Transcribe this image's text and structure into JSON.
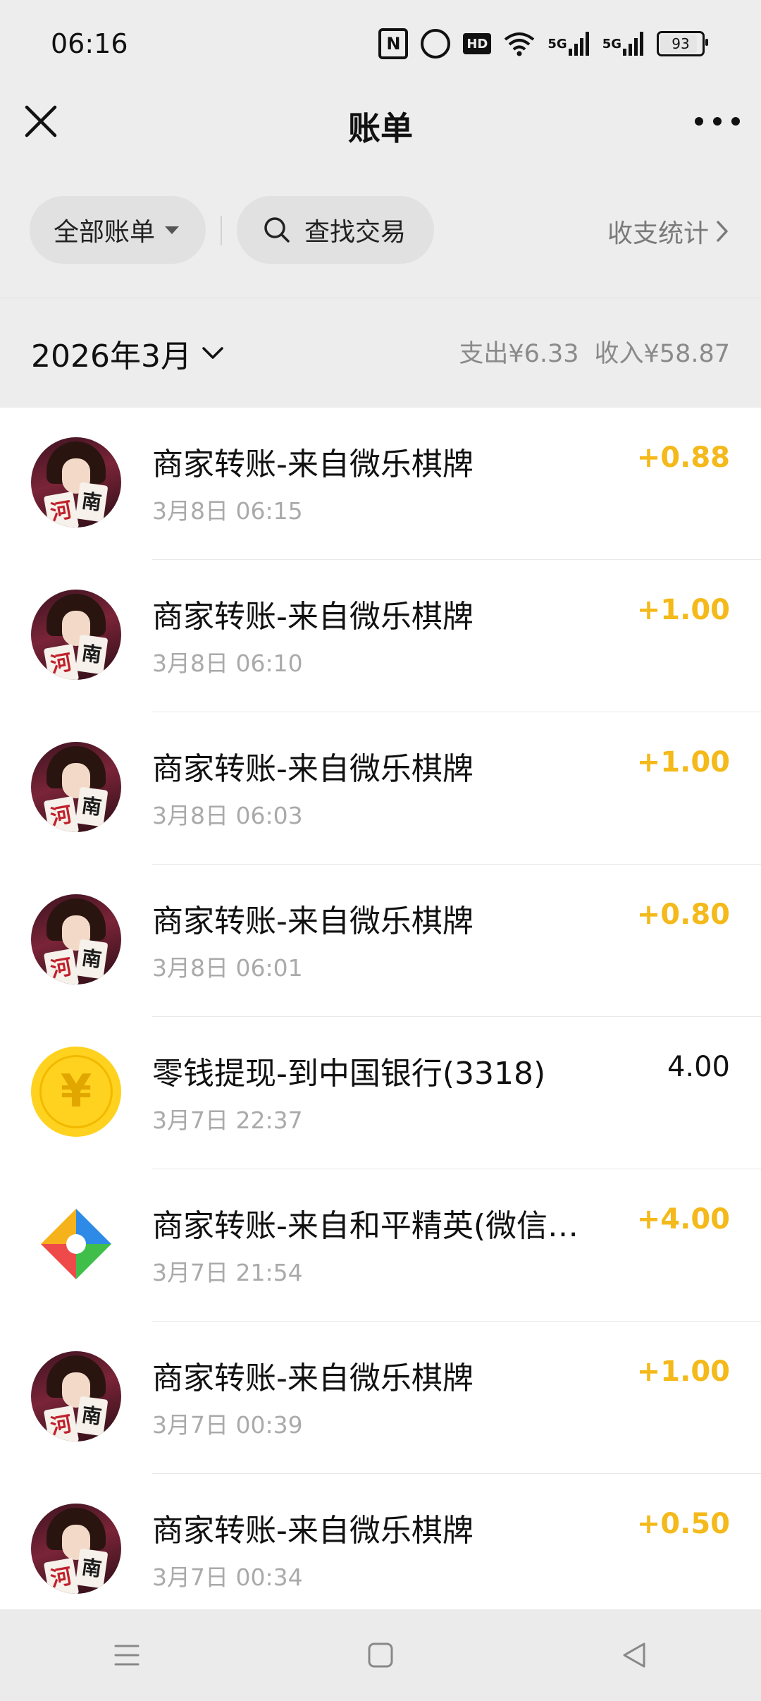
{
  "status_bar": {
    "time": "06:16",
    "nfc_label": "N",
    "hd_label": "HD",
    "signal_1_label": "5G",
    "signal_2_label": "5G",
    "battery_level": "93"
  },
  "header": {
    "title": "账单"
  },
  "filters": {
    "all_bills_label": "全部账单",
    "search_label": "查找交易",
    "stats_label": "收支统计"
  },
  "month_bar": {
    "month_label": "2026年3月",
    "expense_label": "支出¥6.33",
    "income_label": "收入¥58.87"
  },
  "transactions": [
    {
      "title": "商家转账-来自微乐棋牌",
      "date": "3月8日 06:15",
      "amount": "+0.88",
      "avatar": "game",
      "tile_1": "河",
      "tile_2": "南"
    },
    {
      "title": "商家转账-来自微乐棋牌",
      "date": "3月8日 06:10",
      "amount": "+1.00",
      "avatar": "game",
      "tile_1": "河",
      "tile_2": "南"
    },
    {
      "title": "商家转账-来自微乐棋牌",
      "date": "3月8日 06:03",
      "amount": "+1.00",
      "avatar": "game",
      "tile_1": "河",
      "tile_2": "南"
    },
    {
      "title": "商家转账-来自微乐棋牌",
      "date": "3月8日 06:01",
      "amount": "+0.80",
      "avatar": "game",
      "tile_1": "河",
      "tile_2": "南"
    },
    {
      "title": "零钱提现-到中国银行(3318)",
      "date": "3月7日 22:37",
      "amount": "4.00",
      "avatar": "coin",
      "coin_symbol": "¥"
    },
    {
      "title": "商家转账-来自和平精英(微信…",
      "date": "3月7日 21:54",
      "amount": "+4.00",
      "avatar": "logo"
    },
    {
      "title": "商家转账-来自微乐棋牌",
      "date": "3月7日 00:39",
      "amount": "+1.00",
      "avatar": "game",
      "tile_1": "河",
      "tile_2": "南"
    },
    {
      "title": "商家转账-来自微乐棋牌",
      "date": "3月7日 00:34",
      "amount": "+0.50",
      "avatar": "game",
      "tile_1": "河",
      "tile_2": "南"
    }
  ],
  "colors": {
    "income_amount": "#f4b91a",
    "page_background": "#ededed",
    "secondary_text": "#aaaaaa",
    "coin_yellow": "#ffd21f"
  },
  "nav_icons": [
    "menu-icon",
    "home-square-icon",
    "back-triangle-icon"
  ]
}
